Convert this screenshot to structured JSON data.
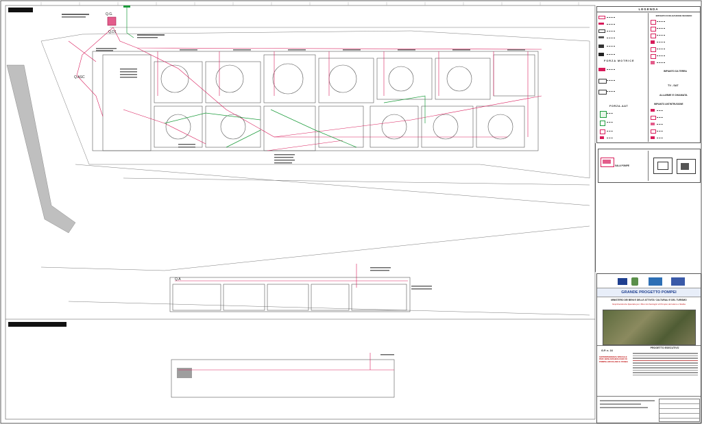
{
  "legend": {
    "title": "LEGENDA",
    "sections": [
      {
        "label": "IMPIANTO DI RILEVAZIONE INCENDIO"
      },
      {
        "label": "FORZA MOTRICE"
      },
      {
        "label": "IMPIANTO DA TERRA"
      },
      {
        "label": "TV - SAT"
      },
      {
        "label": "ALLARME E CHIAMATA"
      },
      {
        "label": "IMPIANTO ANTINTRUSIONE"
      },
      {
        "label": "FORZA-AAT"
      }
    ],
    "detail_label": "SALA POMPE"
  },
  "titleblock": {
    "project_title": "GRANDE PROGETTO POMPEI",
    "ministry": "MINISTERO DEI BENI E DELLE ATTIVITA' CULTURALI E DEL TURISMO",
    "subtitle": "Soprintendenza Speciale per i Beni Archeologici di Pompei, Ercolano e Stabia",
    "phase": "PROGETTO ESECUTIVO",
    "sheet_code": "G.P. n. 16",
    "authority": "SOPRINTENDENZA SPECIALE PER I BENI ARCHEOLOGICI DI POMPEI, ERCOLANO E STABIA"
  },
  "plan": {
    "labels": {
      "qg": "Q.G.",
      "qd1": "Q.D1",
      "qasc": "Q.ASC",
      "qa": "Q.A"
    }
  },
  "colors": {
    "wire": "#d81b5a",
    "green": "#1a9b3a",
    "grey_area": "#bfbfbf",
    "building": "#555555",
    "grid": "#d0d0d0"
  }
}
